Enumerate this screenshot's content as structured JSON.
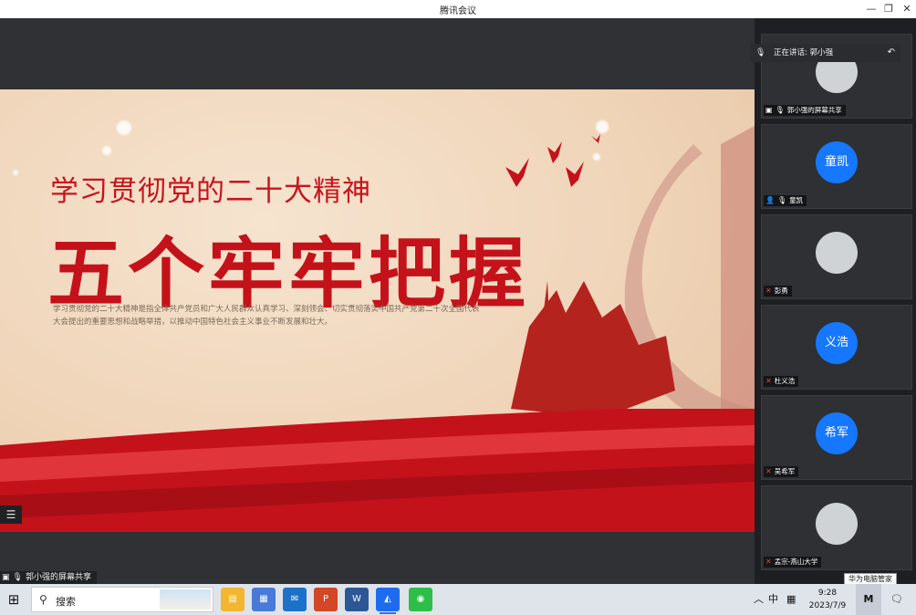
{
  "window": {
    "title": "腾讯会议"
  },
  "slide": {
    "subtitle": "学习贯彻党的二十大精神",
    "main_title": "五个牢牢把握",
    "body": "学习贯彻党的二十大精神是指全体共产党员和广大人民群众认真学习、深刻领会、切实贯彻落实中国共产党第二十次全国代表大会提出的重要思想和战略举措，以推动中国特色社会主义事业不断发展和壮大。"
  },
  "share_label": "郭小强的屏幕共享",
  "speaking": {
    "label": "正在讲话: 郭小强"
  },
  "participants": [
    {
      "name": "郭小强的屏幕共享",
      "avatar_text": "",
      "kind": "screen",
      "avatar_style": "photo"
    },
    {
      "name": "童凯",
      "avatar_text": "童凯",
      "kind": "host",
      "avatar_style": "blue"
    },
    {
      "name": "彭勇",
      "avatar_text": "",
      "kind": "member",
      "avatar_style": "photo"
    },
    {
      "name": "杜义浩",
      "avatar_text": "义浩",
      "kind": "member",
      "avatar_style": "blue"
    },
    {
      "name": "吴希军",
      "avatar_text": "希军",
      "kind": "member",
      "avatar_style": "blue"
    },
    {
      "name": "孟宗-燕山大学",
      "avatar_text": "",
      "kind": "member",
      "avatar_style": "photo"
    }
  ],
  "tooltip": "华为电脑管家",
  "taskbar": {
    "search_placeholder": "搜索",
    "ime": "中",
    "time": "9:28",
    "date": "2023/7/9",
    "apps": [
      "file-explorer",
      "microsoft-store",
      "mail",
      "powerpoint",
      "word",
      "tencent-meeting",
      "wechat"
    ]
  },
  "colors": {
    "accent_red": "#c4121a",
    "avatar_blue": "#1677ff"
  }
}
